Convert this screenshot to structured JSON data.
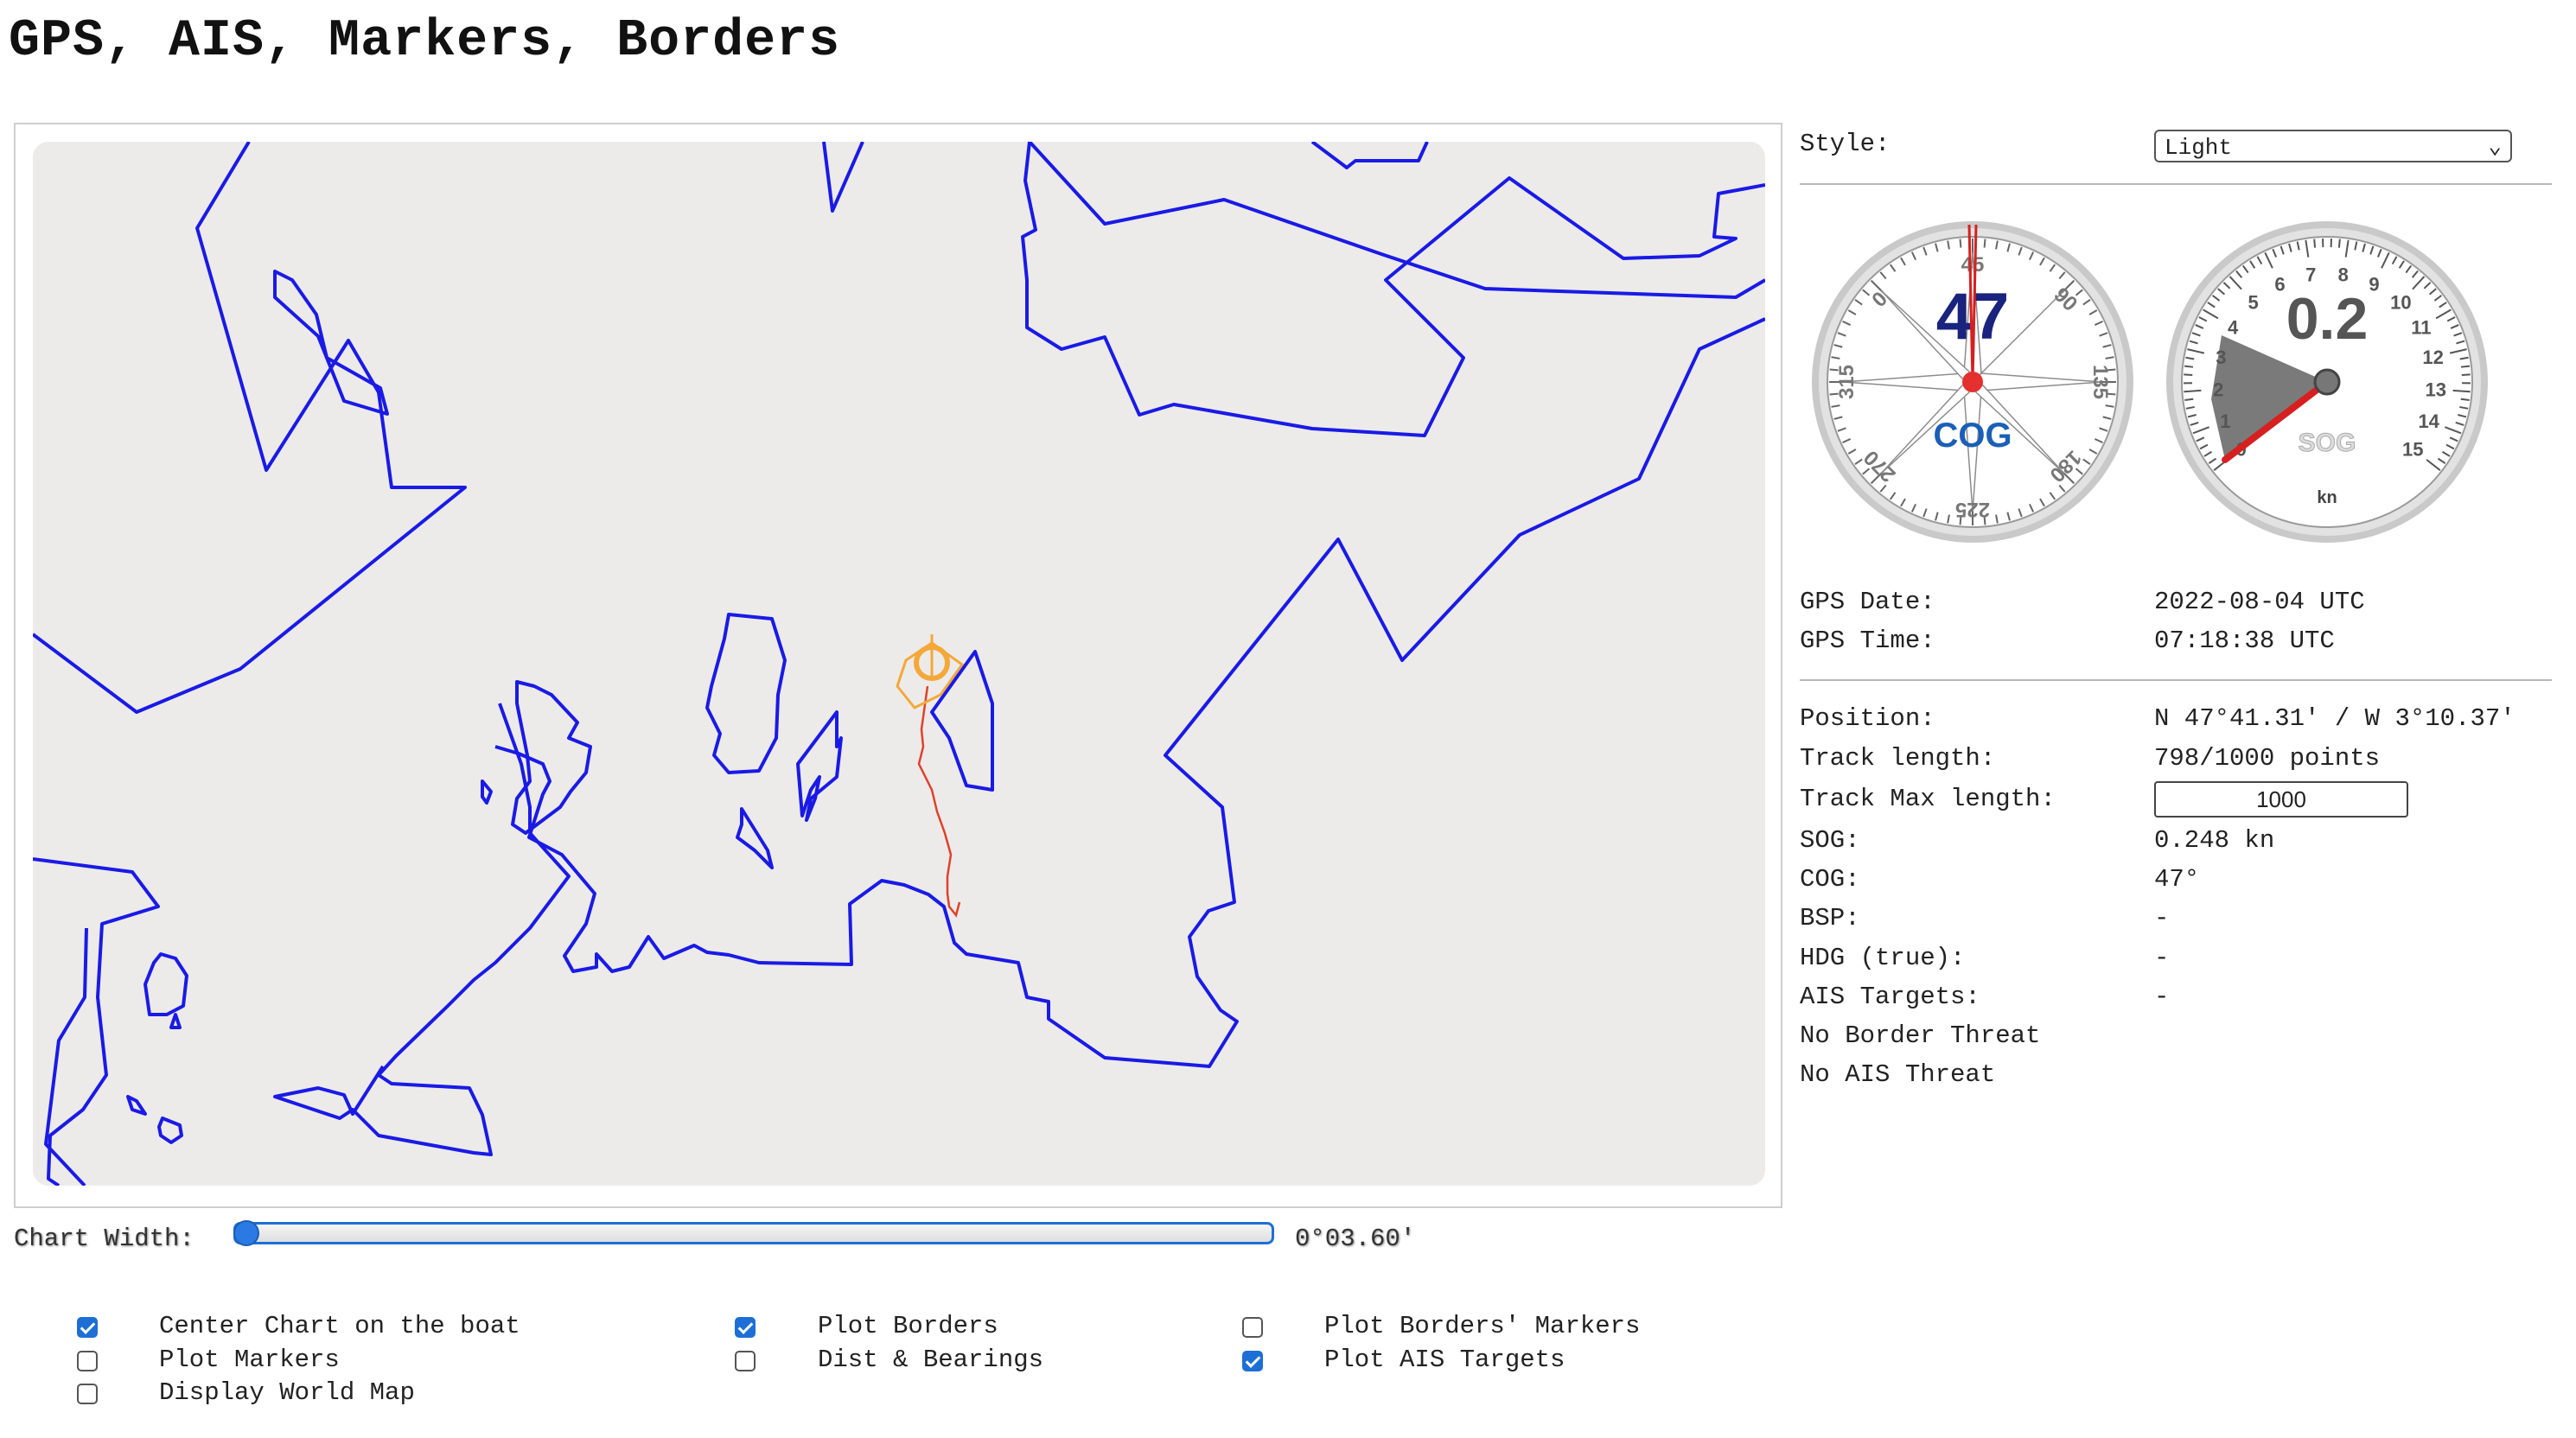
{
  "page": {
    "title": "GPS, AIS, Markers, Borders"
  },
  "chart": {
    "background_color": "#ecebea",
    "border_color": "#1a1ae6",
    "track_color": "#e0402c",
    "boat_color": "#f4a83a"
  },
  "chart_width": {
    "label": "Chart Width:",
    "value": "0°03.60'",
    "slider_fraction": 0.0
  },
  "options": {
    "center_chart": {
      "label": "Center Chart on the boat",
      "checked": true
    },
    "plot_markers": {
      "label": "Plot Markers",
      "checked": false
    },
    "display_world_map": {
      "label": "Display World Map",
      "checked": false
    },
    "plot_borders": {
      "label": "Plot Borders",
      "checked": true
    },
    "dist_bearings": {
      "label": "Dist & Bearings",
      "checked": false
    },
    "plot_borders_markers": {
      "label": "Plot Borders' Markers",
      "checked": false
    },
    "plot_ais_targets": {
      "label": "Plot AIS Targets",
      "checked": true
    }
  },
  "style": {
    "label": "Style:",
    "selected": "Light"
  },
  "cog_gauge": {
    "value": "47",
    "label": "COG",
    "ticks": [
      "0",
      "45",
      "90",
      "135",
      "180",
      "225",
      "270",
      "315"
    ]
  },
  "sog_gauge": {
    "value": "0.2",
    "label": "SOG",
    "unit": "kn",
    "ticks": [
      "0",
      "1",
      "2",
      "3",
      "4",
      "5",
      "6",
      "7",
      "8",
      "9",
      "10",
      "11",
      "12",
      "13",
      "14",
      "15"
    ]
  },
  "gps": {
    "date_label": "GPS Date:",
    "date_value": "2022-08-04 UTC",
    "time_label": "GPS Time:",
    "time_value": "07:18:38 UTC"
  },
  "info": {
    "position_label": "Position:",
    "position_value": "N 47°41.31' / W 3°10.37'",
    "track_length_label": "Track length:",
    "track_length_value": "798/1000 points",
    "track_max_label": "Track Max length:",
    "track_max_value": "1000",
    "sog_label": "SOG:",
    "sog_value": "0.248 kn",
    "cog_label": "COG:",
    "cog_value": "47°",
    "bsp_label": "BSP:",
    "bsp_value": "-",
    "hdg_label": "HDG (true):",
    "hdg_value": "-",
    "ais_label": "AIS Targets:",
    "ais_value": "-",
    "border_threat": "No Border Threat",
    "ais_threat": "No AIS Threat"
  }
}
